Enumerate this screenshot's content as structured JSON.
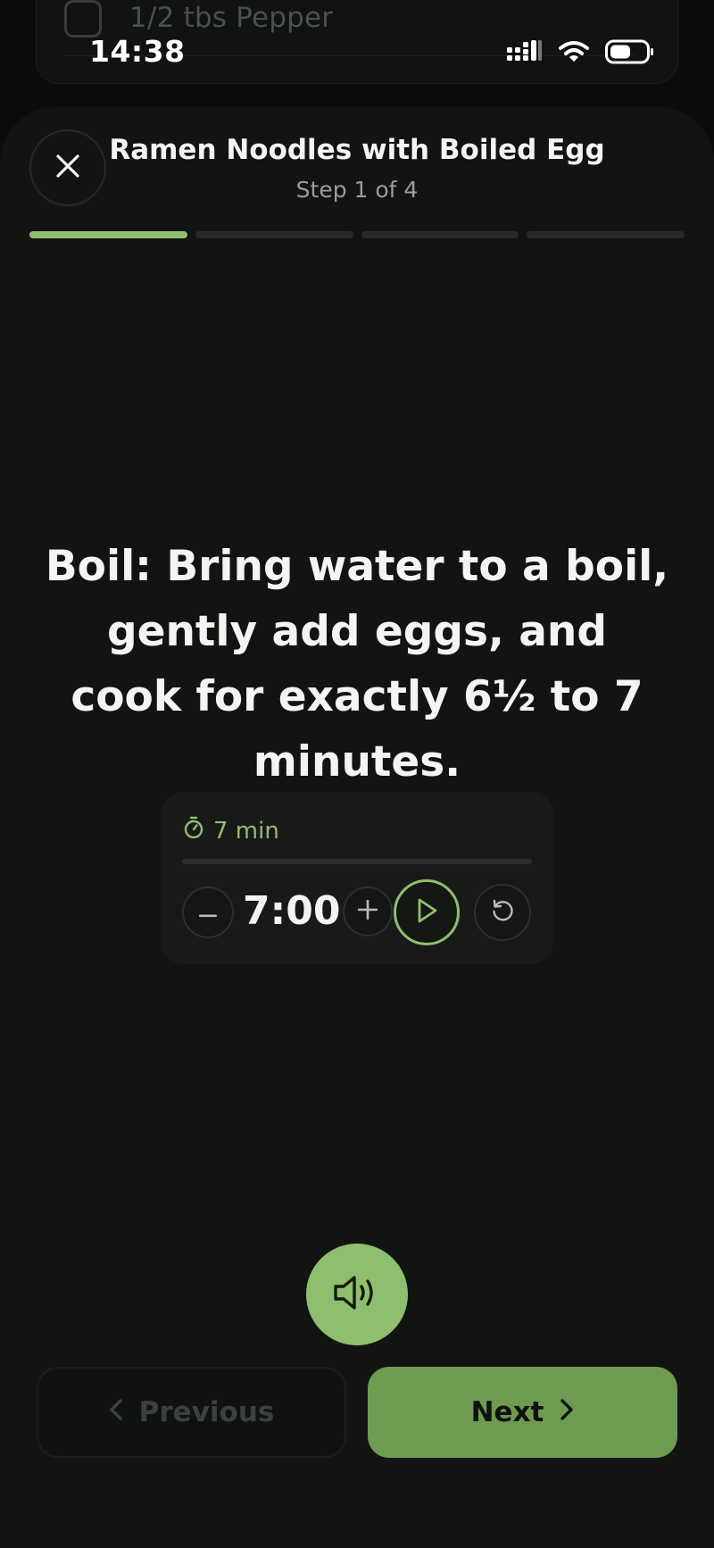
{
  "status_bar": {
    "time": "14:38",
    "icons": [
      "signal-icon",
      "wifi-icon",
      "battery-icon"
    ]
  },
  "background_list": {
    "item_text": "1/2 tbs Pepper",
    "checked": false
  },
  "header": {
    "title": "Ramen Noodles with Boiled Egg",
    "subtitle": "Step 1 of 4",
    "close_icon": "close-icon"
  },
  "progress": {
    "total_steps": 4,
    "current_step": 1
  },
  "instruction": {
    "text": "Boil: Bring water to a boil, gently add eggs, and cook for exactly 6½ to 7 minutes."
  },
  "timer": {
    "label": "7 min",
    "value": "7:00",
    "progress_fraction": 0,
    "icons": [
      "stopwatch-icon",
      "minus-icon",
      "plus-icon",
      "play-icon",
      "reset-icon"
    ]
  },
  "speaker": {
    "icon": "speaker-icon"
  },
  "navigation": {
    "previous_label": "Previous",
    "next_label": "Next",
    "previous_enabled": false
  },
  "colors": {
    "accent": "#8fbf6e",
    "next_button": "#6e9a52",
    "background": "#0b0c0b",
    "sheet": "#121412"
  }
}
